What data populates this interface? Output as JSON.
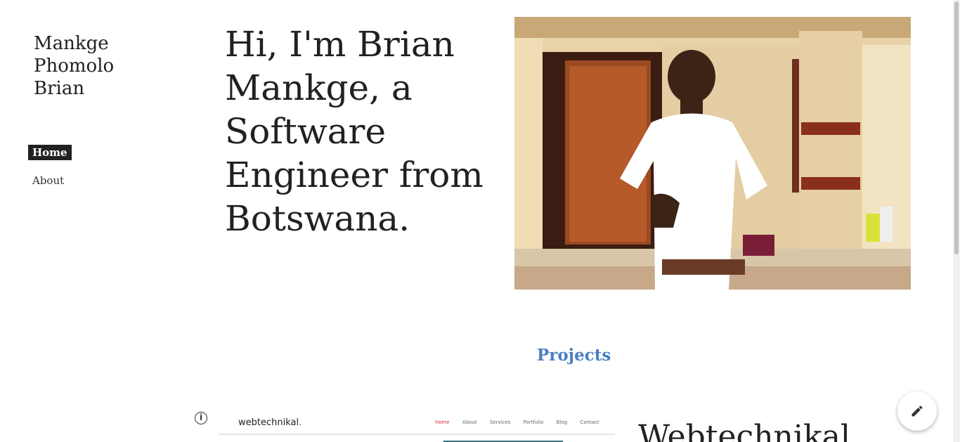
{
  "site": {
    "title_lines": [
      "Mankge",
      "Phomolo",
      "Brian"
    ]
  },
  "nav": {
    "items": [
      {
        "label": "Home",
        "active": true
      },
      {
        "label": "About",
        "active": false
      }
    ]
  },
  "hero": {
    "headline": "Hi, I'm Brian Mankge, a Software Engineer from Botswana.",
    "photo_icon": "person-portrait-photo"
  },
  "projects": {
    "heading": "Projects",
    "items": [
      {
        "title": "Webtechnikal",
        "preview": {
          "brand": "webtechnikal",
          "brand_dot": ".",
          "links": [
            "Home",
            "About",
            "Services",
            "Portfolio",
            "Blog",
            "Contact"
          ],
          "active_link": "Home"
        }
      }
    ]
  },
  "controls": {
    "info_icon": "info-icon",
    "info_glyph": "i",
    "edit_icon": "pencil-icon"
  },
  "colors": {
    "accent": "#4a7fc1",
    "nav_active_bg": "#212121",
    "preview_highlight": "#dd3333"
  }
}
